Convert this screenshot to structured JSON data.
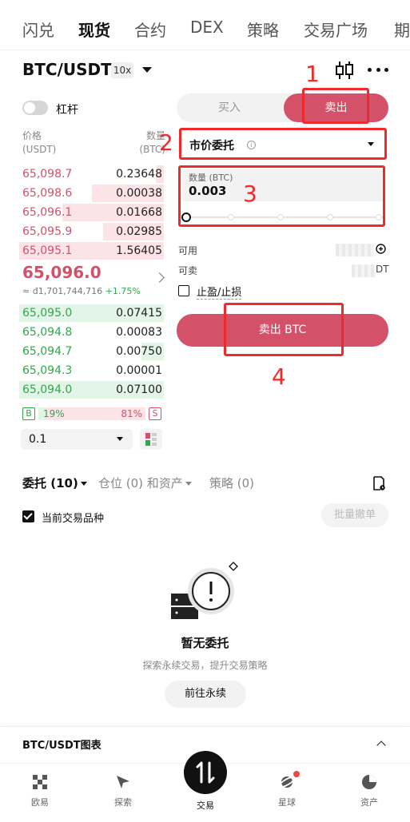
{
  "top_nav": {
    "tabs": [
      {
        "label": "闪兑",
        "active": false
      },
      {
        "label": "现货",
        "active": true
      },
      {
        "label": "合约",
        "active": false
      },
      {
        "label": "DEX",
        "active": false
      },
      {
        "label": "策略",
        "active": false
      },
      {
        "label": "交易广场",
        "active": false
      },
      {
        "label": "期",
        "active": false
      }
    ]
  },
  "header": {
    "pair": "BTC/USDT",
    "leverage": "10x",
    "candle_icon": "candlestick-icon",
    "more_icon": "more-dots-icon"
  },
  "margin_toggle": {
    "label": "杠杆",
    "on": false
  },
  "orderbook": {
    "price_header": "价格",
    "price_unit": "(USDT)",
    "qty_header": "数量",
    "qty_unit": "(BTC)",
    "asks": [
      {
        "price": "65,098.7",
        "qty": "0.23648",
        "depth": 0.05
      },
      {
        "price": "65,098.6",
        "qty": "0.00038",
        "depth": 0.5
      },
      {
        "price": "65,096.1",
        "qty": "0.01668",
        "depth": 0.7
      },
      {
        "price": "65,095.9",
        "qty": "0.02985",
        "depth": 0.42
      },
      {
        "price": "65,095.1",
        "qty": "1.56405",
        "depth": 1.0
      }
    ],
    "last_price": "65,096.0",
    "last_fiat": "≈ đ1,701,744,716",
    "last_change": "+1.75%",
    "bids": [
      {
        "price": "65,095.0",
        "qty": "0.07415",
        "depth": 1.0
      },
      {
        "price": "65,094.8",
        "qty": "0.00083",
        "depth": 0.0
      },
      {
        "price": "65,094.7",
        "qty": "0.00750",
        "depth": 0.15
      },
      {
        "price": "65,094.3",
        "qty": "0.00001",
        "depth": 0.0
      },
      {
        "price": "65,094.0",
        "qty": "0.07100",
        "depth": 1.0
      }
    ],
    "buy_ratio": "19%",
    "sell_ratio": "81%",
    "buy_ratio_value": 0.19,
    "b_label": "B",
    "s_label": "S",
    "depth_value": "0.1"
  },
  "order_form": {
    "buy_label": "买入",
    "sell_label": "卖出",
    "order_type": "市价委托",
    "qty_label": "数量 (BTC)",
    "qty_value": "0.003",
    "slider_value": 0,
    "available_label": "可用",
    "sellable_label": "可卖",
    "sellable_suffix": "DT",
    "tpsl_label": "止盈/止损",
    "submit_label": "卖出 BTC"
  },
  "annotations": [
    "1",
    "2",
    "3",
    "4"
  ],
  "orders_section": {
    "tabs": [
      {
        "label": "委托 (10)",
        "active": true
      },
      {
        "label": "仓位 (0) 和资产",
        "active": false
      },
      {
        "label": "策略 (0)",
        "active": false
      }
    ],
    "current_pair_label": "当前交易品种",
    "cancel_all_label": "批量撤单",
    "empty_title": "暂无委托",
    "empty_desc": "探索永续交易，提升交易策略",
    "goto_label": "前往永续"
  },
  "chart_panel": {
    "title": "BTC/USDT图表"
  },
  "bottom_nav": {
    "items": [
      {
        "label": "欧易",
        "icon": "okx-logo-icon"
      },
      {
        "label": "探索",
        "icon": "compass-icon"
      },
      {
        "label": "交易",
        "icon": "trade-icon"
      },
      {
        "label": "星球",
        "icon": "planet-icon"
      },
      {
        "label": "资产",
        "icon": "pie-chart-icon"
      }
    ]
  },
  "colors": {
    "sell": "#d4516a",
    "buy": "#2fa84a",
    "annotation": "#f02a2a"
  }
}
